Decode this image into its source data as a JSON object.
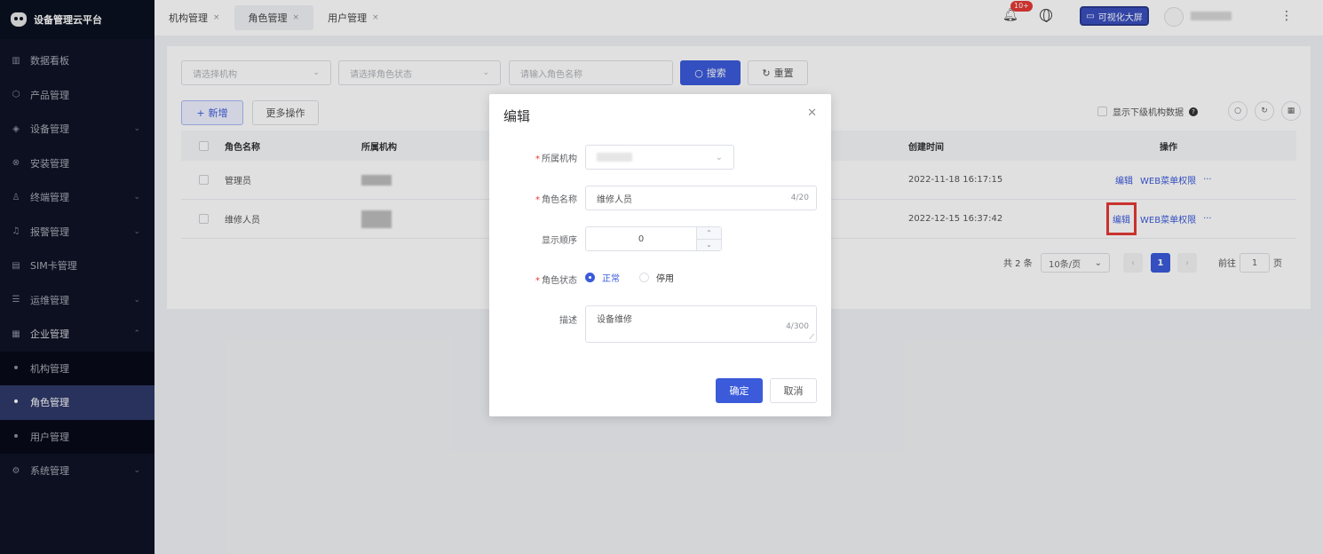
{
  "app": {
    "name": "设备管理云平台"
  },
  "sidebar": {
    "items": [
      {
        "label": "数据看板",
        "icon": "chart-icon",
        "has_children": false
      },
      {
        "label": "产品管理",
        "icon": "cube-icon",
        "has_children": false
      },
      {
        "label": "设备管理",
        "icon": "layers-icon",
        "has_children": true
      },
      {
        "label": "安装管理",
        "icon": "wrench-icon",
        "has_children": false
      },
      {
        "label": "终端管理",
        "icon": "user-icon",
        "has_children": true
      },
      {
        "label": "报警管理",
        "icon": "alarm-icon",
        "has_children": true
      },
      {
        "label": "SIM卡管理",
        "icon": "sim-icon",
        "has_children": false
      },
      {
        "label": "运维管理",
        "icon": "tools-icon",
        "has_children": true
      },
      {
        "label": "企业管理",
        "icon": "building-icon",
        "has_children": true,
        "expanded": true
      }
    ],
    "sub_items": [
      {
        "label": "机构管理",
        "active": false
      },
      {
        "label": "角色管理",
        "active": true
      },
      {
        "label": "用户管理",
        "active": false
      }
    ],
    "last_item": {
      "label": "系统管理",
      "icon": "gear-icon",
      "has_children": true
    }
  },
  "topbar": {
    "tabs": [
      {
        "label": "机构管理",
        "active": false
      },
      {
        "label": "角色管理",
        "active": true
      },
      {
        "label": "用户管理",
        "active": false
      }
    ],
    "notification_badge": "10+",
    "bigscreen_label": "可视化大屏"
  },
  "filters": {
    "org_placeholder": "请选择机构",
    "status_placeholder": "请选择角色状态",
    "name_placeholder": "请输入角色名称",
    "search_label": "搜索",
    "reset_label": "重置"
  },
  "toolbar": {
    "add_label": "新增",
    "more_label": "更多操作",
    "show_sub_label": "显示下级机构数据"
  },
  "table": {
    "headers": {
      "role_name": "角色名称",
      "org": "所属机构",
      "created": "创建时间",
      "actions": "操作"
    },
    "rows": [
      {
        "role_name": "管理员",
        "created": "2022-11-18 16:17:15"
      },
      {
        "role_name": "维修人员",
        "created": "2022-12-15 16:37:42"
      }
    ],
    "actions": {
      "edit": "编辑",
      "web_perm": "WEB菜单权限",
      "more": "···"
    }
  },
  "pagination": {
    "total": "共 2 条",
    "page_size": "10条/页",
    "current_page": "1",
    "goto_label": "前往",
    "goto_value": "1",
    "page_suffix": "页"
  },
  "modal": {
    "title": "编辑",
    "fields": {
      "org_label": "所属机构",
      "role_name_label": "角色名称",
      "role_name_value": "维修人员",
      "role_name_count": "4/20",
      "order_label": "显示顺序",
      "order_value": "0",
      "status_label": "角色状态",
      "status_normal": "正常",
      "status_disabled": "停用",
      "desc_label": "描述",
      "desc_value": "设备维修",
      "desc_count": "4/300"
    },
    "confirm_label": "确定",
    "cancel_label": "取消"
  },
  "colors": {
    "primary": "#3b5bdb",
    "sidebar_bg": "#0e1325",
    "highlight": "#e53935"
  }
}
